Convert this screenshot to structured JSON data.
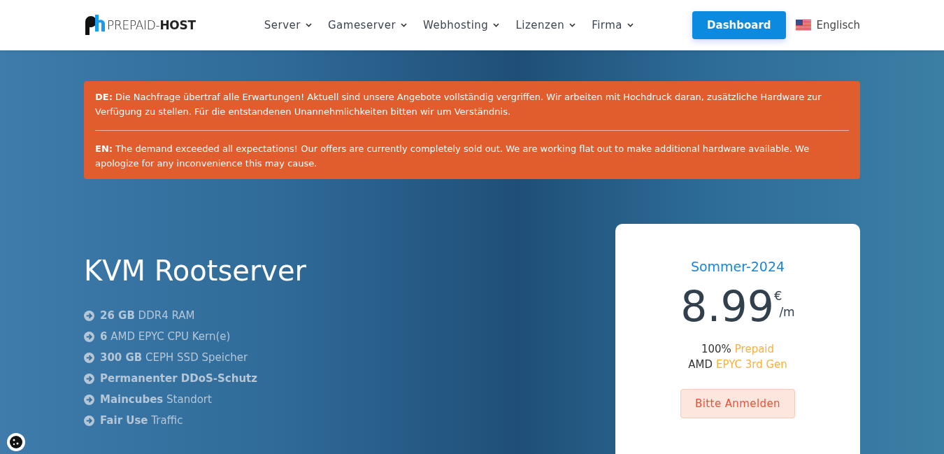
{
  "header": {
    "logo_text": "PREPAID-**HOST**",
    "nav": [
      {
        "label": "Server"
      },
      {
        "label": "Gameserver"
      },
      {
        "label": "Webhosting"
      },
      {
        "label": "Lizenzen"
      },
      {
        "label": "Firma"
      }
    ],
    "dashboard_button": "Dashboard",
    "language": "Englisch"
  },
  "notice": {
    "paragraphs": [
      "**DE:** Die Nachfrage übertraf alle Erwartungen! Aktuell sind unsere Angebote vollständig vergriffen. Wir arbeiten mit Hochdruck daran, zusätzliche Hardware zur Verfügung zu stellen. Für die entstandenen Unannehmlichkeiten bitten wir um Verständnis.",
      "**EN:** The demand exceeded all expectations! Our offers are currently completely sold out. We are working flat out to make additional hardware available. We apologize for any inconvenience this may cause."
    ]
  },
  "hero": {
    "title": "KVM Rootserver",
    "features": [
      "**26 GB** DDR4 RAM",
      "**6** AMD EPYC CPU Kern(e)",
      "**300 GB** CEPH SSD Speicher",
      "**Permanenter DDoS-Schutz**",
      "**Maincubes** Standort",
      "**Fair Use** Traffic"
    ]
  },
  "price_card": {
    "promo": "Sommer-2024",
    "price": "8.99",
    "currency": "€",
    "period": "/m",
    "details": [
      {
        "text": "100%",
        "highlight": "Prepaid"
      },
      {
        "text": "AMD",
        "highlight": "EPYC 3rd Gen"
      }
    ],
    "button": "Bitte Anmelden"
  }
}
